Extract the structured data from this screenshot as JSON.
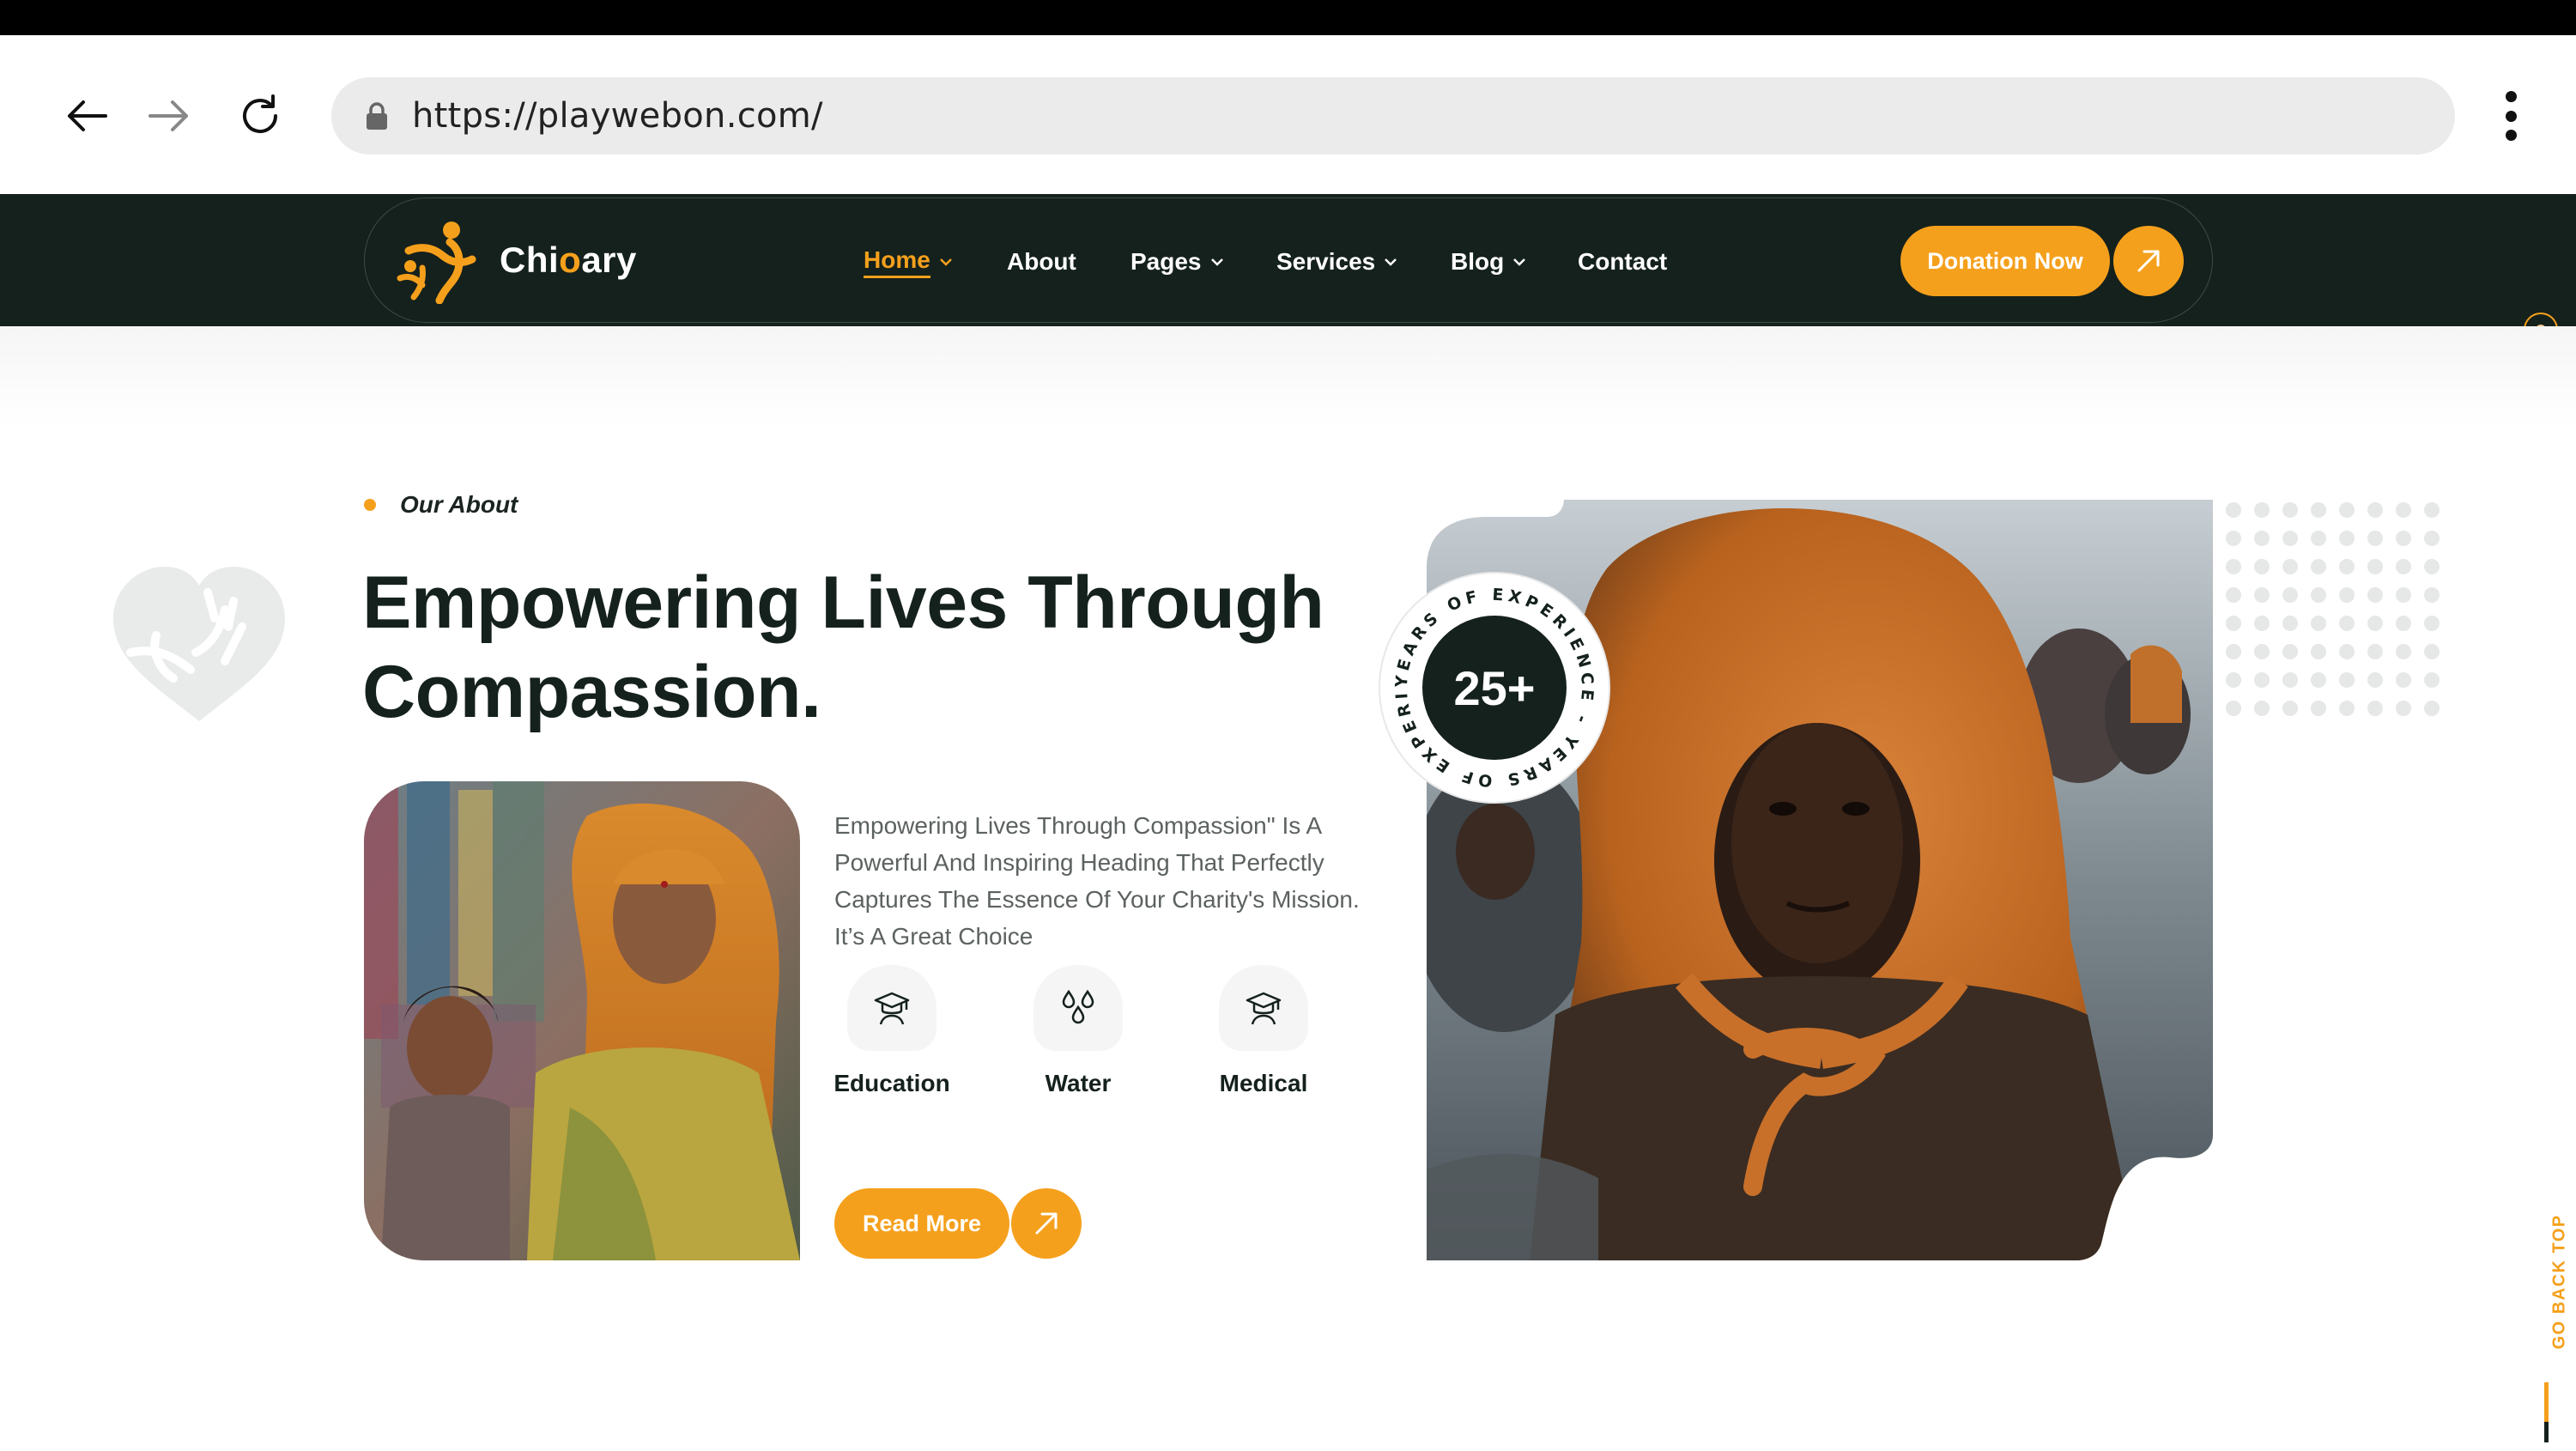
{
  "browser": {
    "url": "https://playwebon.com/",
    "icons": [
      "back-arrow-icon",
      "forward-arrow-icon",
      "reload-icon",
      "lock-icon",
      "kebab-menu-icon"
    ]
  },
  "header": {
    "brand": {
      "prefix": "Chi",
      "accent": "o",
      "suffix": "ary"
    },
    "menu": [
      {
        "label": "Home",
        "active": true,
        "has_dropdown": true
      },
      {
        "label": "About",
        "active": false,
        "has_dropdown": false
      },
      {
        "label": "Pages",
        "active": false,
        "has_dropdown": true
      },
      {
        "label": "Services",
        "active": false,
        "has_dropdown": true
      },
      {
        "label": "Blog",
        "active": false,
        "has_dropdown": true
      },
      {
        "label": "Contact",
        "active": false,
        "has_dropdown": false
      }
    ],
    "cta": "Donation Now"
  },
  "about": {
    "tag": "Our About",
    "heading_line1": "Empowering Lives Through",
    "heading_line2": "Compassion.",
    "description": "Empowering Lives Through Compassion\" Is A Powerful And Inspiring Heading That Perfectly Captures The Essence Of Your Charity's Mission. It’s A Great Choice",
    "features": [
      {
        "label": "Education",
        "icon": "graduation-cap-icon"
      },
      {
        "label": "Water",
        "icon": "water-drops-icon"
      },
      {
        "label": "Medical",
        "icon": "graduation-cap-icon"
      }
    ],
    "read_more": "Read More",
    "experience": {
      "number": "25+",
      "ring_text": "YEARS OF EXPERIENCE - YEARS OF EXPERIENCE - "
    }
  },
  "back_to_top": "GO BACK TOP",
  "colors": {
    "accent": "#f5a01c",
    "dark": "#15211c",
    "text_muted": "#5c625f"
  }
}
